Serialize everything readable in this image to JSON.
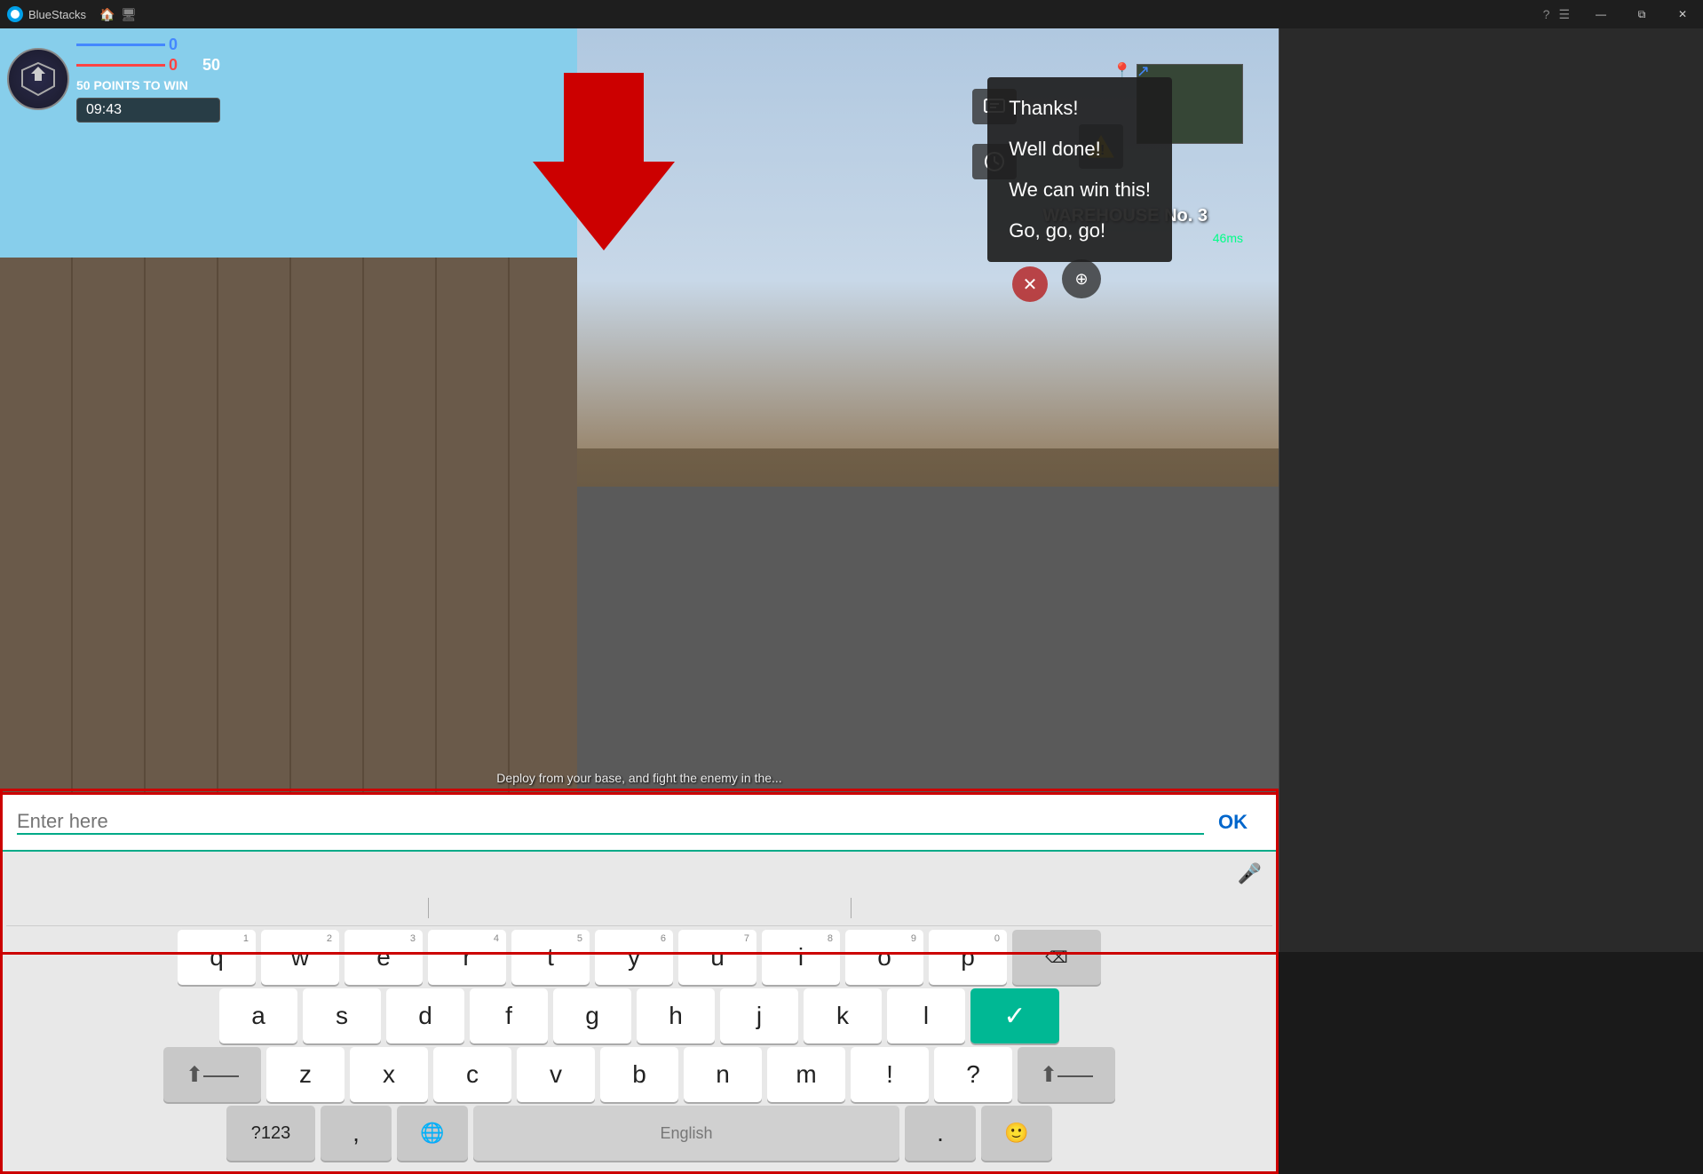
{
  "titlebar": {
    "app_name": "BlueStacks",
    "home_icon": "🏠",
    "monitor_icon": "🖥",
    "help_icon": "?",
    "minimize_icon": "—",
    "maximize_icon": "⧉",
    "close_icon": "✕"
  },
  "game": {
    "score_blue": "0",
    "score_red": "0",
    "score_target": "50",
    "points_to_win": "50 POINTS TO WIN",
    "timer": "09:43",
    "warehouse_label": "WAREHOUSE No. 3",
    "ping": "46ms",
    "bottom_text": "Deploy from your base, and fight the enemy in the..."
  },
  "chat_menu": {
    "items": [
      "Thanks!",
      "Well done!",
      "We can win this!",
      "Go, go, go!"
    ]
  },
  "keyboard": {
    "input_placeholder": "Enter here",
    "ok_label": "OK",
    "rows": {
      "row1": [
        "q",
        "w",
        "e",
        "r",
        "t",
        "y",
        "u",
        "i",
        "o",
        "p"
      ],
      "row1_nums": [
        "1",
        "2",
        "3",
        "4",
        "5",
        "6",
        "7",
        "8",
        "9",
        "0"
      ],
      "row2": [
        "a",
        "s",
        "d",
        "f",
        "g",
        "h",
        "j",
        "k",
        "l"
      ],
      "row3": [
        "z",
        "x",
        "c",
        "v",
        "b",
        "n",
        "m",
        "!",
        "?"
      ],
      "bottom": {
        "special_left": "?123",
        "globe": "🌐",
        "space": "English",
        "period": ".",
        "emoji": "🙂"
      }
    }
  }
}
